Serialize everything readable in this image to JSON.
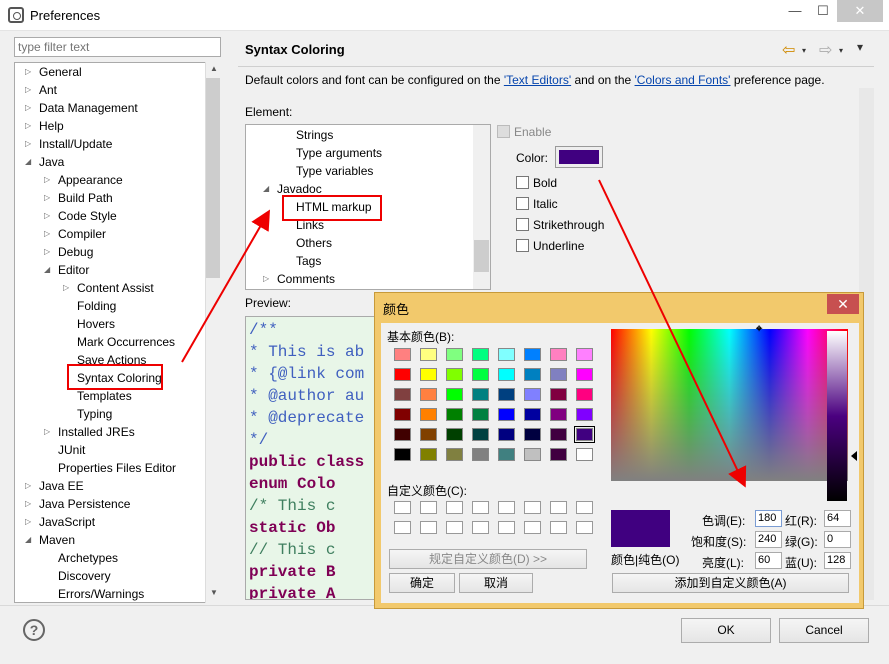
{
  "window": {
    "title": "Preferences",
    "minimize": "—",
    "maximize": "☐",
    "close": "✕"
  },
  "filter": {
    "placeholder": "type filter text"
  },
  "tree": [
    {
      "label": "General",
      "depth": 0,
      "twisty": "▷"
    },
    {
      "label": "Ant",
      "depth": 0,
      "twisty": "▷"
    },
    {
      "label": "Data Management",
      "depth": 0,
      "twisty": "▷"
    },
    {
      "label": "Help",
      "depth": 0,
      "twisty": "▷"
    },
    {
      "label": "Install/Update",
      "depth": 0,
      "twisty": "▷"
    },
    {
      "label": "Java",
      "depth": 0,
      "twisty": "◢"
    },
    {
      "label": "Appearance",
      "depth": 1,
      "twisty": "▷"
    },
    {
      "label": "Build Path",
      "depth": 1,
      "twisty": "▷"
    },
    {
      "label": "Code Style",
      "depth": 1,
      "twisty": "▷"
    },
    {
      "label": "Compiler",
      "depth": 1,
      "twisty": "▷"
    },
    {
      "label": "Debug",
      "depth": 1,
      "twisty": "▷"
    },
    {
      "label": "Editor",
      "depth": 1,
      "twisty": "◢"
    },
    {
      "label": "Content Assist",
      "depth": 2,
      "twisty": "▷"
    },
    {
      "label": "Folding",
      "depth": 2,
      "twisty": ""
    },
    {
      "label": "Hovers",
      "depth": 2,
      "twisty": ""
    },
    {
      "label": "Mark Occurrences",
      "depth": 2,
      "twisty": ""
    },
    {
      "label": "Save Actions",
      "depth": 2,
      "twisty": ""
    },
    {
      "label": "Syntax Coloring",
      "depth": 2,
      "twisty": "",
      "selected": true
    },
    {
      "label": "Templates",
      "depth": 2,
      "twisty": ""
    },
    {
      "label": "Typing",
      "depth": 2,
      "twisty": ""
    },
    {
      "label": "Installed JREs",
      "depth": 1,
      "twisty": "▷"
    },
    {
      "label": "JUnit",
      "depth": 1,
      "twisty": ""
    },
    {
      "label": "Properties Files Editor",
      "depth": 1,
      "twisty": ""
    },
    {
      "label": "Java EE",
      "depth": 0,
      "twisty": "▷"
    },
    {
      "label": "Java Persistence",
      "depth": 0,
      "twisty": "▷"
    },
    {
      "label": "JavaScript",
      "depth": 0,
      "twisty": "▷"
    },
    {
      "label": "Maven",
      "depth": 0,
      "twisty": "◢"
    },
    {
      "label": "Archetypes",
      "depth": 1,
      "twisty": ""
    },
    {
      "label": "Discovery",
      "depth": 1,
      "twisty": ""
    },
    {
      "label": "Errors/Warnings",
      "depth": 1,
      "twisty": ""
    }
  ],
  "page": {
    "title": "Syntax Coloring",
    "desc_prefix": "Default colors and font can be configured on the ",
    "link1": "'Text Editors'",
    "desc_mid": " and on the ",
    "link2": "'Colors and Fonts'",
    "desc_suffix": " preference page.",
    "element_label": "Element:",
    "preview_label": "Preview:",
    "nav_back": "⇦",
    "nav_fwd": "⇨",
    "nav_menu": "▾"
  },
  "elements": [
    {
      "label": "Strings",
      "depth": 2,
      "twisty": ""
    },
    {
      "label": "Type arguments",
      "depth": 2,
      "twisty": ""
    },
    {
      "label": "Type variables",
      "depth": 2,
      "twisty": ""
    },
    {
      "label": "Javadoc",
      "depth": 1,
      "twisty": "◢"
    },
    {
      "label": "HTML markup",
      "depth": 2,
      "twisty": "",
      "selected": true
    },
    {
      "label": "Links",
      "depth": 2,
      "twisty": ""
    },
    {
      "label": "Others",
      "depth": 2,
      "twisty": ""
    },
    {
      "label": "Tags",
      "depth": 2,
      "twisty": ""
    },
    {
      "label": "Comments",
      "depth": 1,
      "twisty": "▷"
    }
  ],
  "options": {
    "enable": "Enable",
    "color_label": "Color:",
    "color_value": "#400080",
    "bold": "Bold",
    "italic": "Italic",
    "strikethrough": "Strikethrough",
    "underline": "Underline"
  },
  "preview_lines": [
    {
      "text": "/**",
      "color": "#3f5fbf"
    },
    {
      "text": " * This is ab",
      "color": "#3f5fbf"
    },
    {
      "text": " * {@link com",
      "color": "#3f5fbf"
    },
    {
      "text": " * @author au",
      "color": "#3f5fbf"
    },
    {
      "text": " * @deprecate",
      "color": "#3f5fbf"
    },
    {
      "text": " */",
      "color": "#3f5fbf"
    },
    {
      "text": "public class",
      "color": "#7f0055",
      "bold": true
    },
    {
      "text": "    enum Colo",
      "color": "#7f0055",
      "bold": true
    },
    {
      "text": "    /* This c",
      "color": "#3f7f5f"
    },
    {
      "text": "    static Ob",
      "color": "#7f0055",
      "bold": true
    },
    {
      "text": "    // This c",
      "color": "#3f7f5f"
    },
    {
      "text": "    private B",
      "color": "#7f0055",
      "bold": true
    },
    {
      "text": "    private A",
      "color": "#7f0055",
      "bold": true
    }
  ],
  "buttons": {
    "ok": "OK",
    "cancel": "Cancel",
    "help": "?"
  },
  "color_dialog": {
    "title": "颜色",
    "close": "✕",
    "basic_colors_label": "基本颜色(B):",
    "custom_colors_label": "自定义颜色(C):",
    "define_custom": "规定自定义颜色(D) >>",
    "ok": "确定",
    "cancel": "取消",
    "color_solid": "颜色|纯色(O)",
    "add_custom": "添加到自定义颜色(A)",
    "hue_label": "色调(E):",
    "hue": "180",
    "sat_label": "饱和度(S):",
    "sat": "240",
    "lum_label": "亮度(L):",
    "lum": "60",
    "red_label": "红(R):",
    "red": "64",
    "green_label": "绿(G):",
    "green": "0",
    "blue_label": "蓝(U):",
    "blue": "128",
    "selected_color": "#400080",
    "basic_colors": [
      "#ff8080",
      "#ffff80",
      "#80ff80",
      "#00ff80",
      "#80ffff",
      "#0080ff",
      "#ff80c0",
      "#ff80ff",
      "#ff0000",
      "#ffff00",
      "#80ff00",
      "#00ff40",
      "#00ffff",
      "#0080c0",
      "#8080c0",
      "#ff00ff",
      "#804040",
      "#ff8040",
      "#00ff00",
      "#008080",
      "#004080",
      "#8080ff",
      "#800040",
      "#ff0080",
      "#800000",
      "#ff8000",
      "#008000",
      "#008040",
      "#0000ff",
      "#0000a0",
      "#800080",
      "#8000ff",
      "#400000",
      "#804000",
      "#004000",
      "#004040",
      "#000080",
      "#000040",
      "#400040",
      "#400080",
      "#000000",
      "#808000",
      "#808040",
      "#808080",
      "#408080",
      "#c0c0c0",
      "#400040",
      "#ffffff"
    ]
  }
}
